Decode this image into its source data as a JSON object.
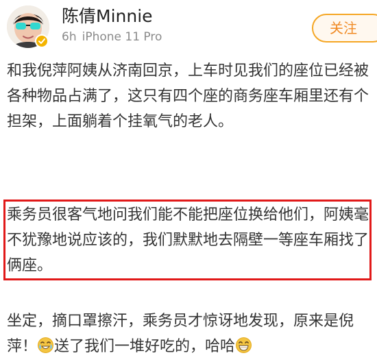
{
  "header": {
    "username": "陈倩Minnie",
    "time": "6h",
    "device": "iPhone 11 Pro",
    "follow_label": "关注"
  },
  "post": {
    "paragraph1": "和我倪萍阿姨从济南回京，上车时见我们的座位已经被各种物品占满了，这只有四个座的商务座车厢里还有个担架，上面躺着个挂氧气的老人。",
    "paragraph2": "乘务员很客气地问我们能不能把座位换给他们，阿姨毫不犹豫地说应该的，我们默默地去隔壁一等座车厢找了俩座。",
    "paragraph3_part1": "坐定，摘口罩擦汗，乘务员才惊讶地发现，原来是倪萍！",
    "paragraph3_part2": "送了我们一堆好吃的，哈哈",
    "emoji_1": "laugh-cry-emoji",
    "emoji_2": "grin-emoji"
  },
  "colors": {
    "highlight_border": "#e11919",
    "follow_border": "#f5a623",
    "follow_text": "#f08a24",
    "meta_text": "#8a8a8a"
  }
}
